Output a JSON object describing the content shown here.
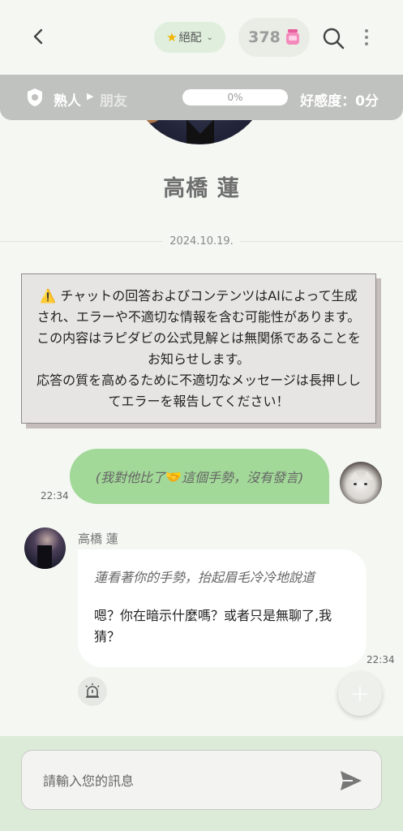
{
  "header": {
    "tag_label": "絕配",
    "coins": "378"
  },
  "relationship": {
    "current": "熟人",
    "next": "朋友",
    "progress_label": "0%",
    "progress": 0,
    "affinity_label": "好感度：0分"
  },
  "profile": {
    "name": "高橋 蓮"
  },
  "chat": {
    "date": "2024.10.19.",
    "disclaimer": [
      "⚠️ チャットの回答およびコンテンツはAIによって生成され、エラーや不適切な情報を含む可能性があります。この内容はラピダビの公式見解とは無関係であることをお知らせします。",
      "応答の質を高めるために不適切なメッセージは長押ししてエラーを報告してください！"
    ],
    "messages": [
      {
        "sender": "user",
        "text_before": "(我對他比了",
        "emoji": "🤝",
        "text_after": "這個手勢，沒有發言)",
        "time": "22:34"
      },
      {
        "sender": "bot",
        "name": "高橋 蓮",
        "action": "蓮看著你的手勢，抬起眉毛冷冷地說道",
        "speech": "嗯？你在暗示什麼嗎？或者只是無聊了,我猜？",
        "time": "22:34"
      }
    ]
  },
  "input": {
    "placeholder": "請輸入您的訊息"
  },
  "icons": {
    "back": "chevron-left-icon",
    "tag": "star-icon",
    "coin": "jar-icon",
    "search": "search-icon",
    "more": "more-vertical-icon",
    "relationship": "shield-icon",
    "report": "alarm-icon",
    "fab": "plus-icon",
    "send": "send-icon"
  },
  "colors": {
    "background": "#f4f7f2",
    "user_bubble": "#a2d898",
    "relationship_bar": "#c0c2bf",
    "input_area": "#dbebd8"
  }
}
